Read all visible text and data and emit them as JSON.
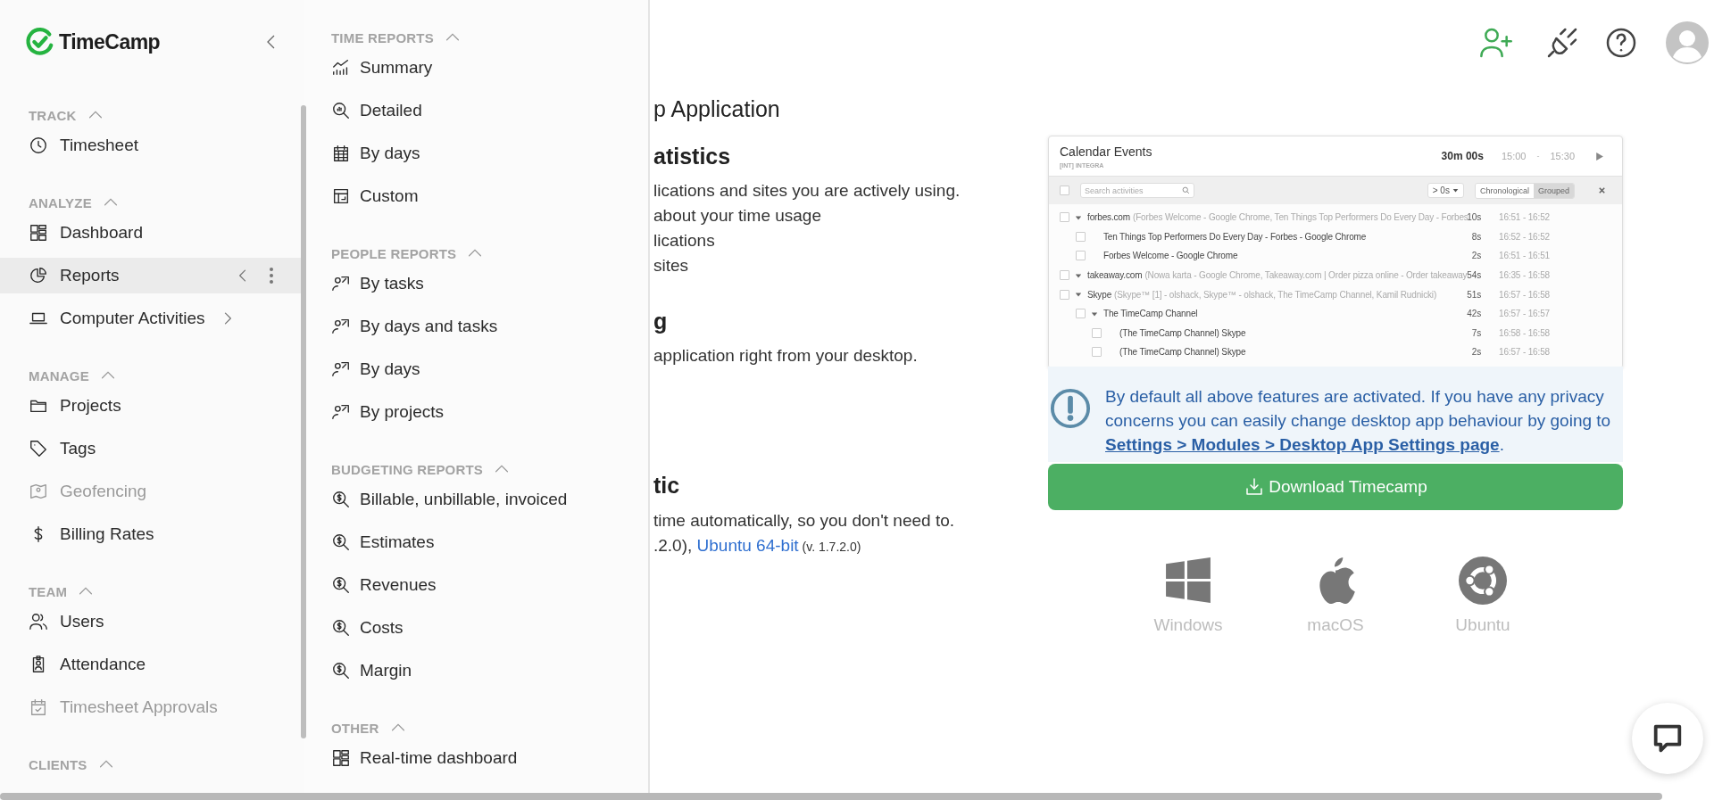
{
  "sidebar": {
    "logo": {
      "text": "TimeCamp"
    },
    "sections": [
      {
        "title": "TRACK",
        "expanded": true,
        "items": [
          {
            "label": "Timesheet",
            "selected": false,
            "disabled": false
          }
        ]
      },
      {
        "title": "ANALYZE",
        "expanded": true,
        "items": [
          {
            "label": "Dashboard",
            "selected": false,
            "disabled": false
          },
          {
            "label": "Reports",
            "selected": true,
            "disabled": false,
            "expanded": true
          },
          {
            "label": "Computer Activities",
            "selected": false,
            "disabled": false,
            "expanded": false
          }
        ]
      },
      {
        "title": "MANAGE",
        "expanded": true,
        "items": [
          {
            "label": "Projects",
            "selected": false,
            "disabled": false
          },
          {
            "label": "Tags",
            "selected": false,
            "disabled": false
          },
          {
            "label": "Geofencing",
            "selected": false,
            "disabled": true
          },
          {
            "label": "Billing Rates",
            "selected": false,
            "disabled": false
          }
        ]
      },
      {
        "title": "TEAM",
        "expanded": true,
        "items": [
          {
            "label": "Users",
            "selected": false,
            "disabled": false
          },
          {
            "label": "Attendance",
            "selected": false,
            "disabled": false
          },
          {
            "label": "Timesheet Approvals",
            "selected": false,
            "disabled": true
          }
        ]
      },
      {
        "title": "CLIENTS",
        "expanded": true
      }
    ]
  },
  "reports_menu": {
    "sections": [
      {
        "title": "TIME REPORTS",
        "expanded": true,
        "items": [
          {
            "label": "Summary",
            "selected": false
          },
          {
            "label": "Detailed",
            "selected": false
          },
          {
            "label": "By days",
            "selected": false
          },
          {
            "label": "Custom",
            "selected": false
          }
        ]
      },
      {
        "title": "PEOPLE REPORTS",
        "expanded": true,
        "items": [
          {
            "label": "By tasks",
            "selected": false
          },
          {
            "label": "By days and tasks",
            "selected": false
          },
          {
            "label": "By days",
            "selected": false
          },
          {
            "label": "By projects",
            "selected": false
          }
        ]
      },
      {
        "title": "BUDGETING REPORTS",
        "expanded": true,
        "items": [
          {
            "label": "Billable, unbillable, invoiced",
            "selected": false
          },
          {
            "label": "Estimates",
            "selected": false
          },
          {
            "label": "Revenues",
            "selected": false
          },
          {
            "label": "Costs",
            "selected": false
          },
          {
            "label": "Margin",
            "selected": false
          }
        ]
      },
      {
        "title": "OTHER",
        "expanded": true,
        "items": [
          {
            "label": "Real-time dashboard",
            "selected": false
          }
        ]
      }
    ]
  },
  "content": {
    "blocks": [
      {
        "kind": "heading",
        "text": "p Application"
      },
      {
        "kind": "subheading",
        "text": "atistics"
      },
      {
        "kind": "text",
        "text": "lications and sites you are actively using."
      },
      {
        "kind": "text",
        "text": "about your time usage"
      },
      {
        "kind": "text",
        "text": "lications"
      },
      {
        "kind": "text",
        "text": "sites"
      },
      {
        "kind": "subheading",
        "text": "g"
      },
      {
        "kind": "text",
        "text": "application right from your desktop."
      },
      {
        "kind": "subheading",
        "text": "tic"
      },
      {
        "kind": "text",
        "text": "time automatically, so you don't need to."
      },
      {
        "kind": "links",
        "before": ".2.0), ",
        "link": "Ubuntu 64-bit",
        "after": " (v. 1.7.2.0)"
      }
    ]
  },
  "preview": {
    "title": "Calendar Events",
    "subtitle": "[INT] INTEGRA",
    "duration": "30m 00s",
    "start": "15:00",
    "separator": "-",
    "end": "15:30",
    "select_all_checked": false,
    "search_placeholder": "Search activities",
    "min_filter": "> 0s",
    "views": [
      {
        "label": "Chronological",
        "selected": false
      },
      {
        "label": "Grouped",
        "selected": true
      }
    ],
    "rows": [
      {
        "name": "forbes.com",
        "detail": "(Forbes Welcome - Google Chrome, Ten Things Top Performers Do Every Day - Forbes",
        "duration": "10s",
        "range": "16:51 - 16:52",
        "checked": false,
        "expanded": true,
        "children": [
          {
            "name": "Ten Things Top Performers Do Every Day - Forbes - Google Chrome",
            "duration": "8s",
            "range": "16:52 - 16:52",
            "checked": false
          },
          {
            "name": "Forbes Welcome - Google Chrome",
            "duration": "2s",
            "range": "16:51 - 16:51",
            "checked": false
          }
        ]
      },
      {
        "name": "takeaway.com",
        "detail": "(Nowa karta - Google Chrome, Takeaway.com | Order pizza online - Order takeaway",
        "duration": "54s",
        "range": "16:35 - 16:58",
        "checked": false,
        "expanded": true
      },
      {
        "name": "Skype",
        "detail": "(Skype™ [1] - olshack, Skype™ - olshack, The TimeCamp Channel, Kamil Rudnicki)",
        "duration": "51s",
        "range": "16:57 - 16:58",
        "checked": false,
        "expanded": true,
        "children": [
          {
            "name": "The TimeCamp Channel",
            "duration": "42s",
            "range": "16:57 - 16:57",
            "checked": false,
            "expanded": true,
            "children": [
              {
                "name": "(The TimeCamp Channel) Skype",
                "duration": "7s",
                "range": "16:58 - 16:58",
                "checked": false
              },
              {
                "name": "(The TimeCamp Channel) Skype",
                "duration": "2s",
                "range": "16:57 - 16:58",
                "checked": false
              }
            ]
          }
        ]
      }
    ]
  },
  "notice": {
    "text": "By default all above features are activated. If you have any privacy concerns you can easily change desktop app behaviour by going to ",
    "link": "Settings > Modules > Desktop App Settings page",
    "after": "."
  },
  "download_button": {
    "label": "Download Timecamp"
  },
  "platforms": [
    {
      "label": "Windows"
    },
    {
      "label": "macOS"
    },
    {
      "label": "Ubuntu"
    }
  ]
}
